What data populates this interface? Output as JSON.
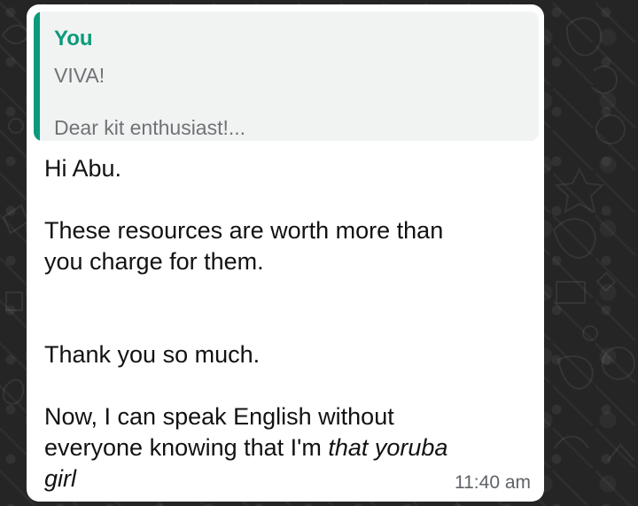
{
  "chat": {
    "quote": {
      "sender": "You",
      "line_1": "VIVA!",
      "line_2": "Dear kit enthusiast!..."
    },
    "message": {
      "greeting": "Hi Abu.",
      "resource_line_1": "These resources are worth more than",
      "resource_line_2": "you charge for them.",
      "thanks": "Thank you so much.",
      "english_line_1": "Now, I can speak English without",
      "english_line_2_plain": "everyone knowing that I'm ",
      "english_line_2_italic": "that yoruba",
      "english_line_3_italic": "girl",
      "time": "11:40 am"
    }
  },
  "theme": {
    "wallpaper": "#252525",
    "bubble": "#ffffff",
    "quote_background": "#f1f3f2",
    "accent": "#0a9b7b",
    "message_text": "#121212",
    "muted_text": "#6f7377"
  },
  "icons": {
    "wallpaper": "chat-wallpaper-doodles-icon"
  }
}
